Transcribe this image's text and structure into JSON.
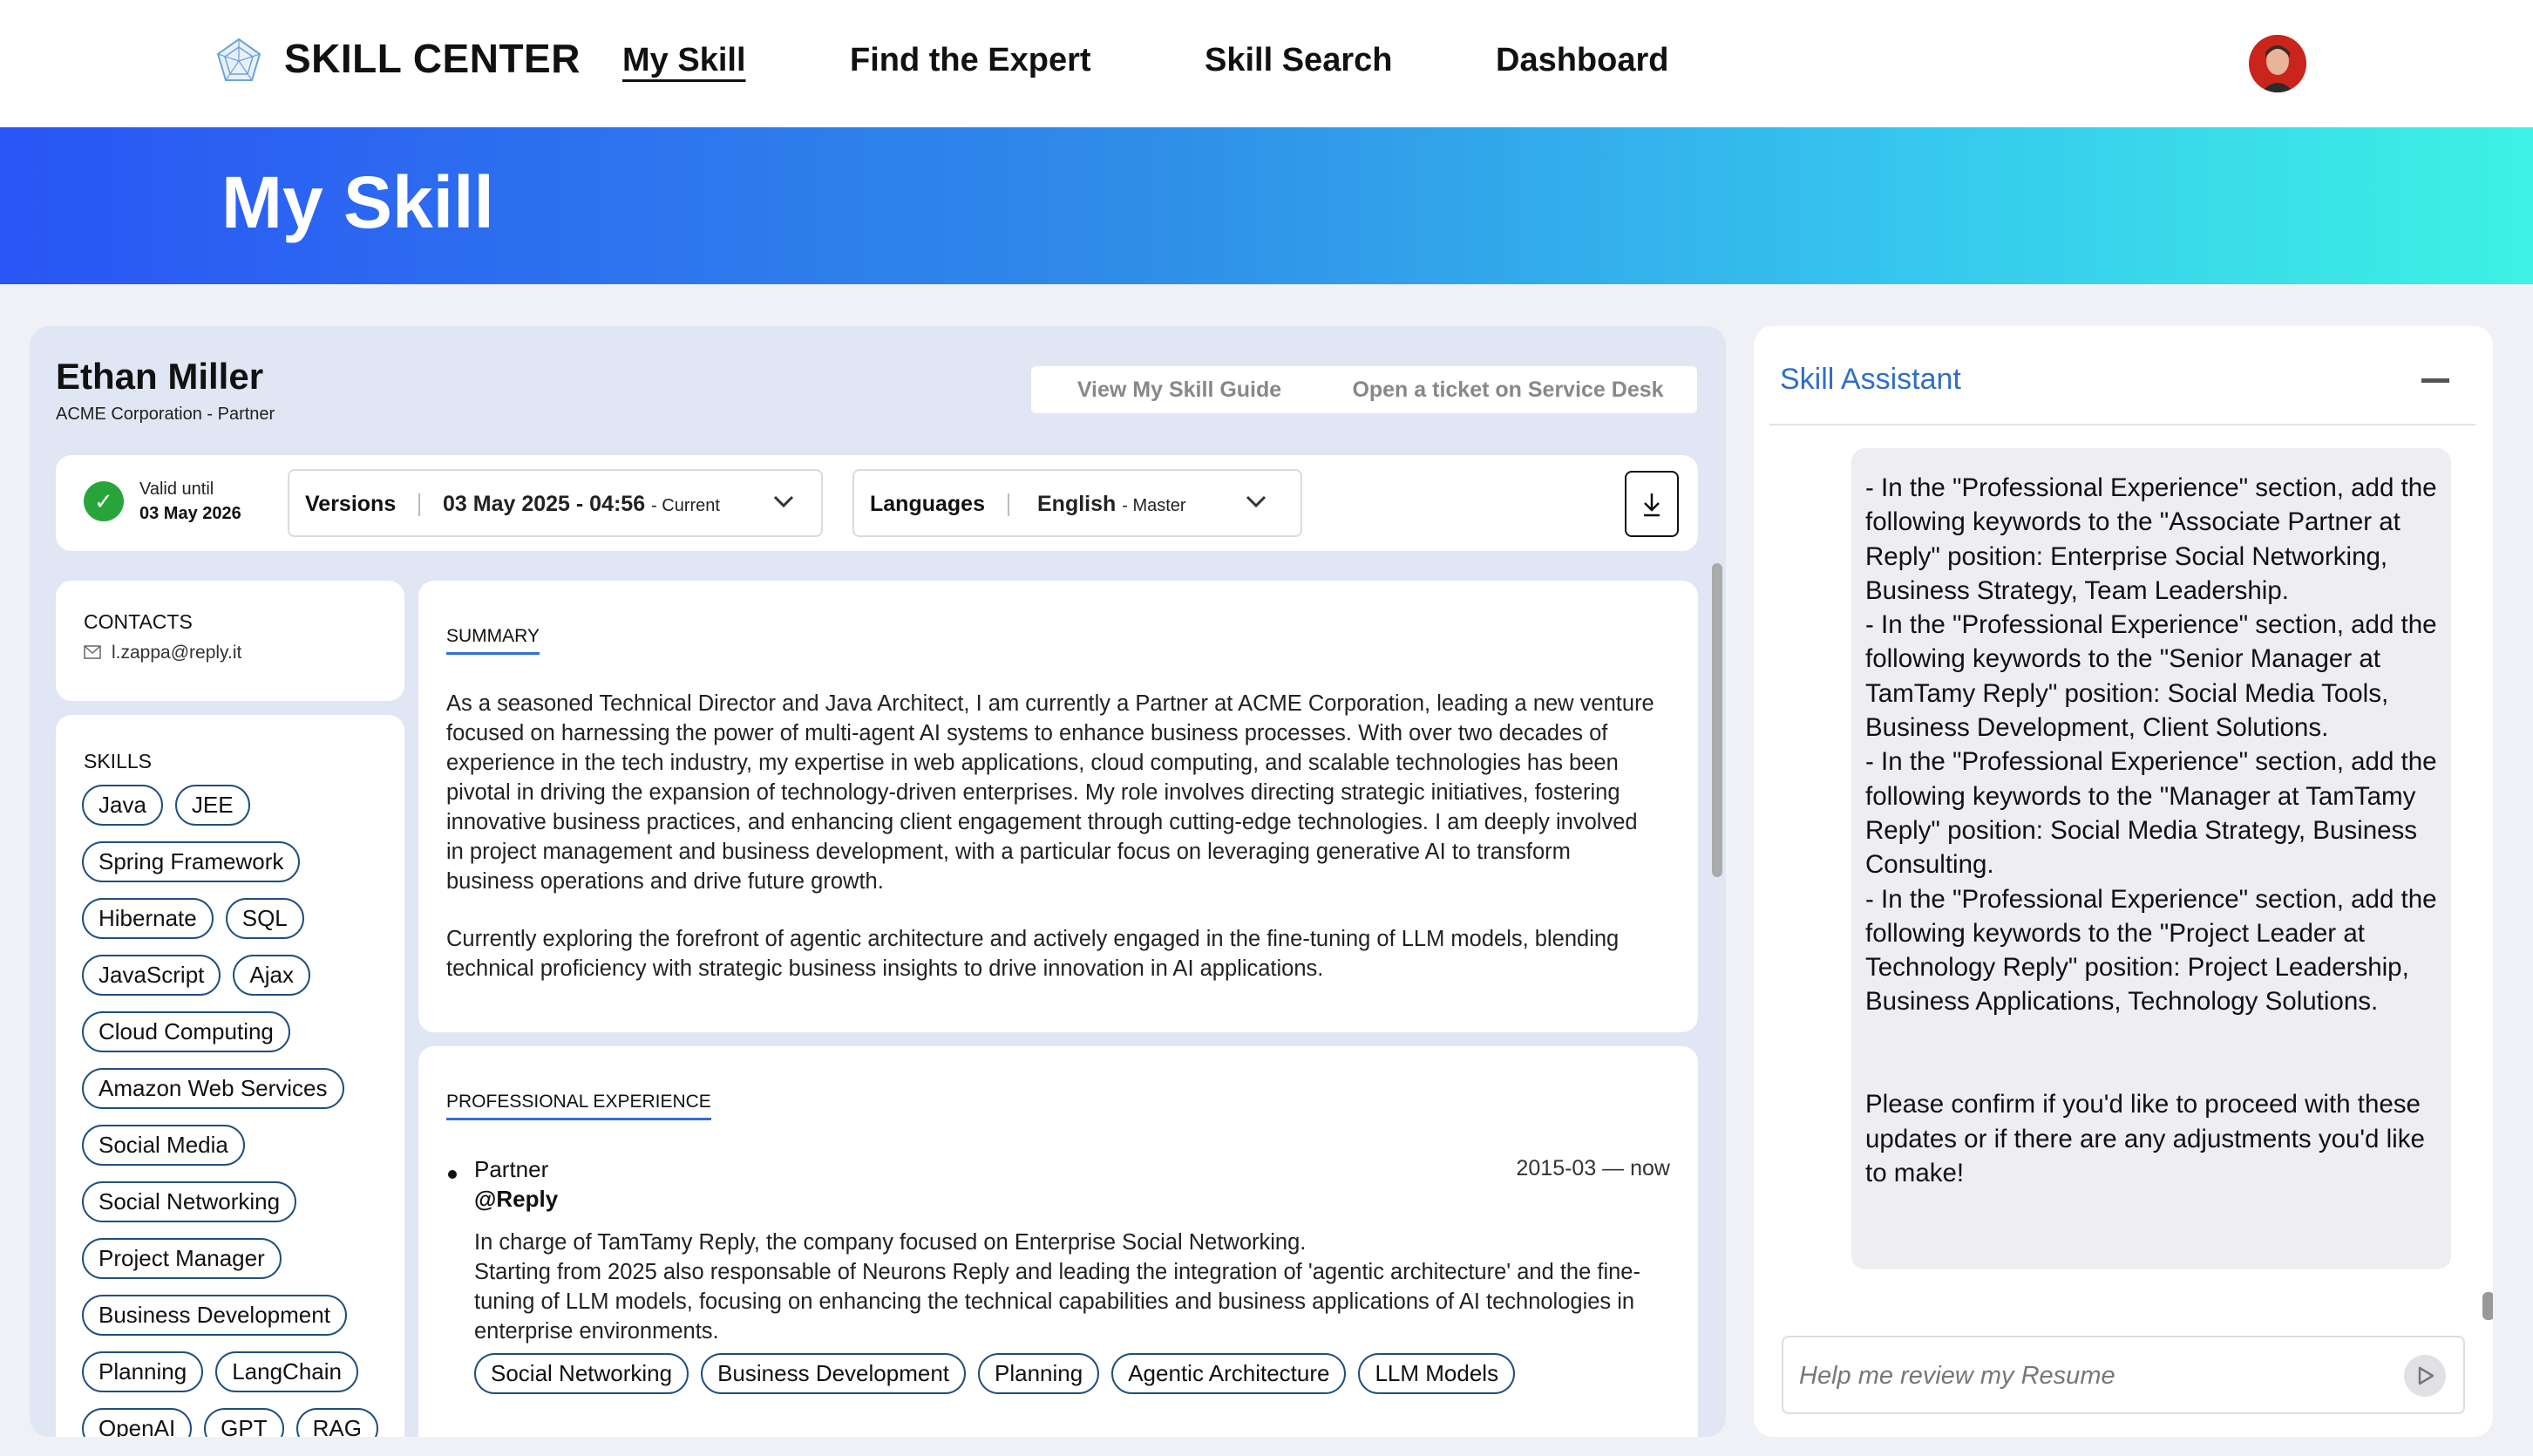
{
  "nav": {
    "brand": "SKILL CENTER",
    "items": [
      {
        "label": "My Skill"
      },
      {
        "label": "Find the Expert"
      },
      {
        "label": "Skill Search"
      },
      {
        "label": "Dashboard"
      }
    ]
  },
  "hero": {
    "title": "My Skill"
  },
  "profile": {
    "name": "Ethan Miller",
    "org": "ACME Corporation - Partner",
    "buttons": {
      "guide": "View My Skill Guide",
      "ticket": "Open a ticket on Service Desk"
    }
  },
  "status": {
    "valid_label": "Valid until",
    "valid_date": "03 May 2026",
    "versions": {
      "label": "Versions",
      "value": "03 May 2025 - 04:56",
      "suffix": "- Current"
    },
    "languages": {
      "label": "Languages",
      "value": "English",
      "suffix": "- Master"
    }
  },
  "contacts": {
    "title": "CONTACTS",
    "email": "l.zappa@reply.it"
  },
  "skills": {
    "title": "SKILLS",
    "rows": [
      [
        "Java",
        "JEE"
      ],
      [
        "Spring Framework"
      ],
      [
        "Hibernate",
        "SQL"
      ],
      [
        "JavaScript",
        "Ajax"
      ],
      [
        "Cloud Computing"
      ],
      [
        "Amazon Web Services"
      ],
      [
        "Social Media"
      ],
      [
        "Social Networking"
      ],
      [
        "Project Manager"
      ],
      [
        "Business Development"
      ],
      [
        "Planning",
        "LangChain"
      ],
      [
        "OpenAI",
        "GPT",
        "RAG"
      ]
    ]
  },
  "summary": {
    "title": "SUMMARY",
    "p1": "As a seasoned Technical Director and Java Architect, I am currently a Partner at ACME Corporation, leading a new venture focused on harnessing the power of multi-agent AI systems to enhance business processes. With over two decades of experience in the tech industry, my expertise in web applications, cloud computing, and scalable technologies has been pivotal in driving the expansion of technology-driven enterprises. My role involves directing strategic initiatives, fostering innovative business practices, and enhancing client engagement through cutting-edge technologies. I am deeply involved in project management and business development, with a particular focus on leveraging generative AI to transform business operations and drive future growth.",
    "p2": "Currently exploring the forefront of agentic architecture and actively engaged in the fine-tuning of LLM models, blending technical proficiency with strategic business insights to drive innovation in AI applications."
  },
  "experience": {
    "title": "PROFESSIONAL EXPERIENCE",
    "role": "Partner",
    "company": "@Reply",
    "dates": "2015-03 — now",
    "desc1": "In charge of TamTamy Reply, the company focused on Enterprise Social Networking.",
    "desc2": "Starting from 2025 also responsable of Neurons Reply and leading the integration of 'agentic architecture' and the fine-tuning of LLM models, focusing on enhancing the technical capabilities and business applications of AI technologies in enterprise environments.",
    "tags": [
      "Social Networking",
      "Business Development",
      "Planning",
      "Agentic Architecture",
      "LLM Models"
    ]
  },
  "assistant": {
    "title": "Skill Assistant",
    "message": "- In the \"Professional Experience\" section, add the following keywords to the \"Associate Partner at Reply\" position: Enterprise Social Networking, Business Strategy, Team Leadership.\n- In the \"Professional Experience\" section, add the following keywords to the \"Senior Manager at TamTamy Reply\" position: Social Media Tools, Business Development, Client Solutions.\n- In the \"Professional Experience\" section, add the following keywords to the \"Manager at TamTamy Reply\" position: Social Media Strategy, Business Consulting.\n- In the \"Professional Experience\" section, add the following keywords to the \"Project Leader at Technology Reply\" position: Project Leadership, Business Applications, Technology Solutions.\n\n\nPlease confirm if you'd like to proceed with these updates or if there are any adjustments you'd like to make!",
    "input_placeholder": "Help me review my Resume"
  },
  "colors": {
    "accent": "#2f6fd8",
    "chip_border": "#1f4f7d",
    "valid_green": "#27a53b",
    "hero_start": "#2a55f5",
    "hero_end": "#3df2e4"
  },
  "icons": [
    "logo-icon",
    "avatar",
    "check-star-icon",
    "chevron-down-icon",
    "download-icon",
    "mail-icon",
    "minimize-icon",
    "send-icon"
  ]
}
